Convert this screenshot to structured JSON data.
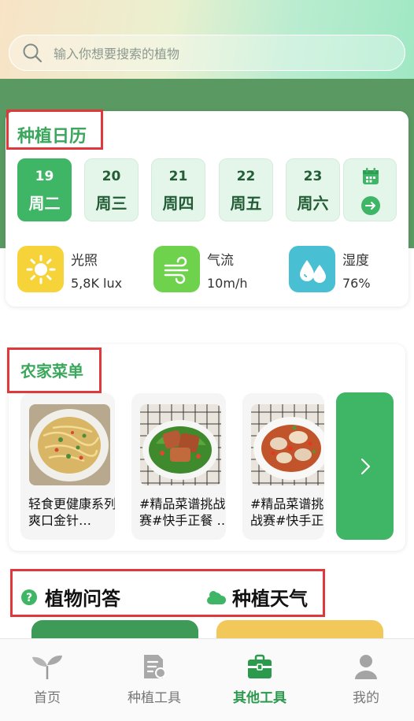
{
  "search": {
    "placeholder": "输入你想要搜索的植物"
  },
  "calendar": {
    "title": "种植日历",
    "days": [
      {
        "num": "19",
        "weekday": "周二",
        "active": true
      },
      {
        "num": "20",
        "weekday": "周三",
        "active": false
      },
      {
        "num": "21",
        "weekday": "周四",
        "active": false
      },
      {
        "num": "22",
        "weekday": "周五",
        "active": false
      },
      {
        "num": "23",
        "weekday": "周六",
        "active": false
      }
    ],
    "weather": [
      {
        "icon": "sun-icon",
        "label": "光照",
        "value": "5,8K lux",
        "color": "#f7d33a"
      },
      {
        "icon": "wind-icon",
        "label": "气流",
        "value": "10m/h",
        "color": "#6fd24d"
      },
      {
        "icon": "water-drops-icon",
        "label": "湿度",
        "value": "76%",
        "color": "#49bfd4"
      }
    ]
  },
  "menu": {
    "title": "农家菜单",
    "recipes": [
      {
        "caption": "轻食更健康系列-爽口金针…"
      },
      {
        "caption": "#精品菜谱挑战赛#快手正餐 …"
      },
      {
        "caption": "#精品菜谱挑战赛#快手正餐"
      }
    ]
  },
  "tools": {
    "qa_label": "植物问答",
    "weather_label": "种植天气"
  },
  "tabbar": {
    "items": [
      {
        "label": "首页",
        "icon": "sprout-icon",
        "active": false
      },
      {
        "label": "种植工具",
        "icon": "document-icon",
        "active": false
      },
      {
        "label": "其他工具",
        "icon": "toolbox-icon",
        "active": true
      },
      {
        "label": "我的",
        "icon": "person-icon",
        "active": false
      }
    ]
  },
  "colors": {
    "accent": "#3fb566",
    "title_green": "#3aa75c",
    "highlight_red": "#e0383b"
  }
}
